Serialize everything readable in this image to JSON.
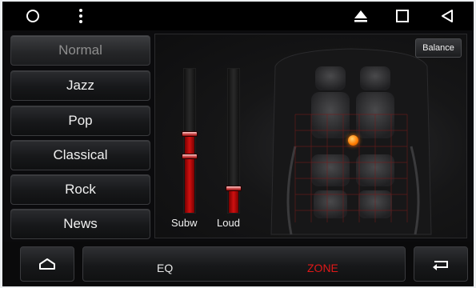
{
  "topbar": {
    "left_icons": [
      "circle-icon",
      "more-vertical-icon"
    ],
    "right_icons": [
      "eject-triangle-icon",
      "square-icon",
      "back-triangle-icon"
    ]
  },
  "presets": [
    {
      "label": "Normal",
      "selected": true
    },
    {
      "label": "Jazz",
      "selected": false
    },
    {
      "label": "Pop",
      "selected": false
    },
    {
      "label": "Classical",
      "selected": false
    },
    {
      "label": "Rock",
      "selected": false
    },
    {
      "label": "News",
      "selected": false
    }
  ],
  "panel": {
    "balance_label": "Balance",
    "sliders": [
      {
        "label": "Subw",
        "level": 0.55
      },
      {
        "label": "Loud",
        "level": 0.17
      }
    ],
    "balance_point_color": "#ff7a00"
  },
  "bottombar": {
    "home_icon": "home-outline-icon",
    "tabs": [
      {
        "label": "EQ",
        "active": false
      },
      {
        "label": "ZONE",
        "active": true
      }
    ],
    "back_icon": "return-arrow-icon"
  },
  "colors": {
    "accent": "#e01818",
    "slider_fill": "#c81010",
    "active_tab_text": "#e01818",
    "inactive_tab_text": "#e8e8e8"
  }
}
